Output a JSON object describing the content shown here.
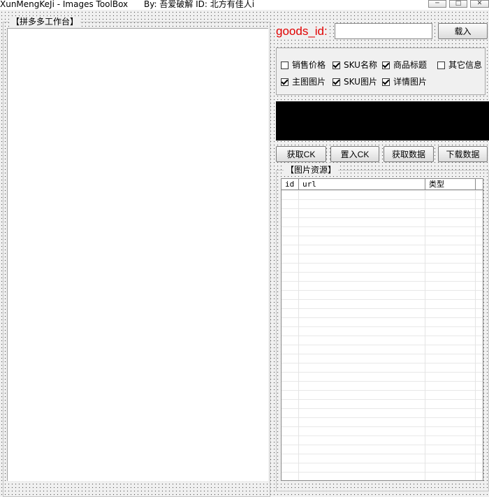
{
  "window": {
    "title": "XunMengKeJi - Images ToolBox",
    "byline": "By:  吾爱破解    ID:  北方有佳人i",
    "minimize": "─",
    "maximize": "□",
    "close": "✕"
  },
  "workbench": {
    "legend": "【拼多多工作台】"
  },
  "goods": {
    "label": "goods_id:",
    "value": "",
    "load_button": "载入"
  },
  "options": [
    {
      "label": "销售价格",
      "checked": false
    },
    {
      "label": "SKU名称",
      "checked": true
    },
    {
      "label": "商品标题",
      "checked": true
    },
    {
      "label": "其它信息",
      "checked": false
    },
    {
      "label": "主图图片",
      "checked": true
    },
    {
      "label": "SKU图片",
      "checked": true
    },
    {
      "label": "详情图片",
      "checked": true
    }
  ],
  "actions": {
    "get_ck": "获取CK",
    "set_ck": "置入CK",
    "fetch_data": "获取数据",
    "download_data": "下载数据"
  },
  "images": {
    "legend": "【图片资源】",
    "columns": [
      "id",
      "url",
      "类型"
    ],
    "rows": []
  }
}
